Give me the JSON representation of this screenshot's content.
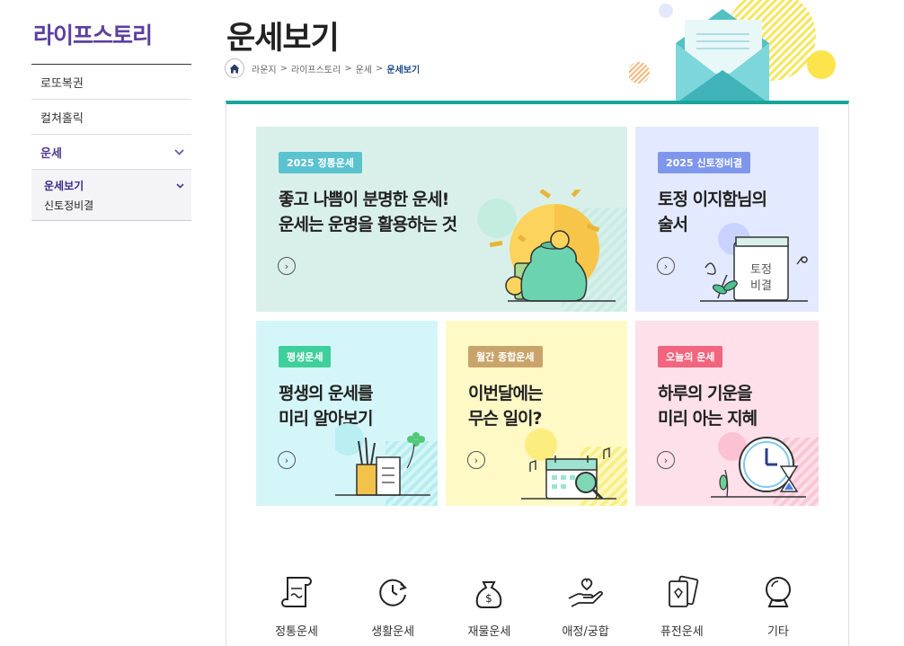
{
  "sidebar": {
    "title": "라이프스토리",
    "items": [
      {
        "label": "로또복권"
      },
      {
        "label": "컬쳐홀릭"
      },
      {
        "label": "운세"
      }
    ],
    "submenu": [
      {
        "label": "운세보기"
      },
      {
        "label": "신토정비결"
      }
    ]
  },
  "header": {
    "title": "운세보기",
    "breadcrumb": [
      "라운지",
      "라이프스토리",
      "운세",
      "운세보기"
    ],
    "separator": ">"
  },
  "cards": [
    {
      "badge": "2025 정통운세",
      "badge_color": "#5bc2cf",
      "line1": "좋고 나쁨이 분명한 운세!",
      "line2": "운세는 운명을 활용하는 것"
    },
    {
      "badge": "2025 신토정비결",
      "badge_color": "#7e97ec",
      "line1": "토정 이지함님의",
      "line2": "술서",
      "book_text1": "토정",
      "book_text2": "비결"
    },
    {
      "badge": "평생운세",
      "badge_color": "#3fcf9c",
      "line1": "평생의 운세를",
      "line2": "미리 알아보기"
    },
    {
      "badge": "월간 종합운세",
      "badge_color": "#c9a46a",
      "line1": "이번달에는",
      "line2": "무슨 일이?"
    },
    {
      "badge": "오늘의 운세",
      "badge_color": "#f2657e",
      "line1": "하루의 기운을",
      "line2": "미리 아는 지혜"
    }
  ],
  "arrow_glyph": "›",
  "categories": [
    {
      "label": "정통운세",
      "icon": "scroll-icon"
    },
    {
      "label": "생활운세",
      "icon": "cycle-clock-icon"
    },
    {
      "label": "재물운세",
      "icon": "money-bag-icon"
    },
    {
      "label": "애정/궁합",
      "icon": "heart-hand-icon"
    },
    {
      "label": "퓨전운세",
      "icon": "cards-icon"
    },
    {
      "label": "기타",
      "icon": "crystal-ball-icon"
    }
  ],
  "colors": {
    "accent": "#17a59b",
    "brand": "#5c3fa0"
  }
}
